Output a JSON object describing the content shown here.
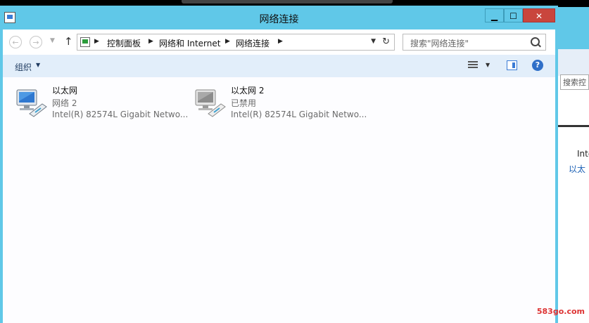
{
  "window": {
    "title": "网络连接",
    "minimize": "▁",
    "maximize": "☐",
    "close": "✕"
  },
  "address": {
    "crumbs": [
      "控制面板",
      "网络和 Internet",
      "网络连接"
    ],
    "search_placeholder": "搜索\"网络连接\""
  },
  "toolbar": {
    "organize_label": "组织",
    "help": "?"
  },
  "connections": [
    {
      "name": "以太网",
      "status": "网络  2",
      "device": "Intel(R) 82574L Gigabit Netwo...",
      "icon": "network-adapter-connected-icon"
    },
    {
      "name": "以太网 2",
      "status": "已禁用",
      "device": "Intel(R) 82574L Gigabit Netwo...",
      "icon": "network-adapter-disabled-icon"
    }
  ],
  "background_window": {
    "search_text": "搜索控",
    "line1": "Intel",
    "line2": "以太"
  },
  "watermark": "583go.com",
  "colors": {
    "titlebar": "#60c8e8",
    "close": "#c9463d",
    "commandbar": "#e2eefa"
  }
}
